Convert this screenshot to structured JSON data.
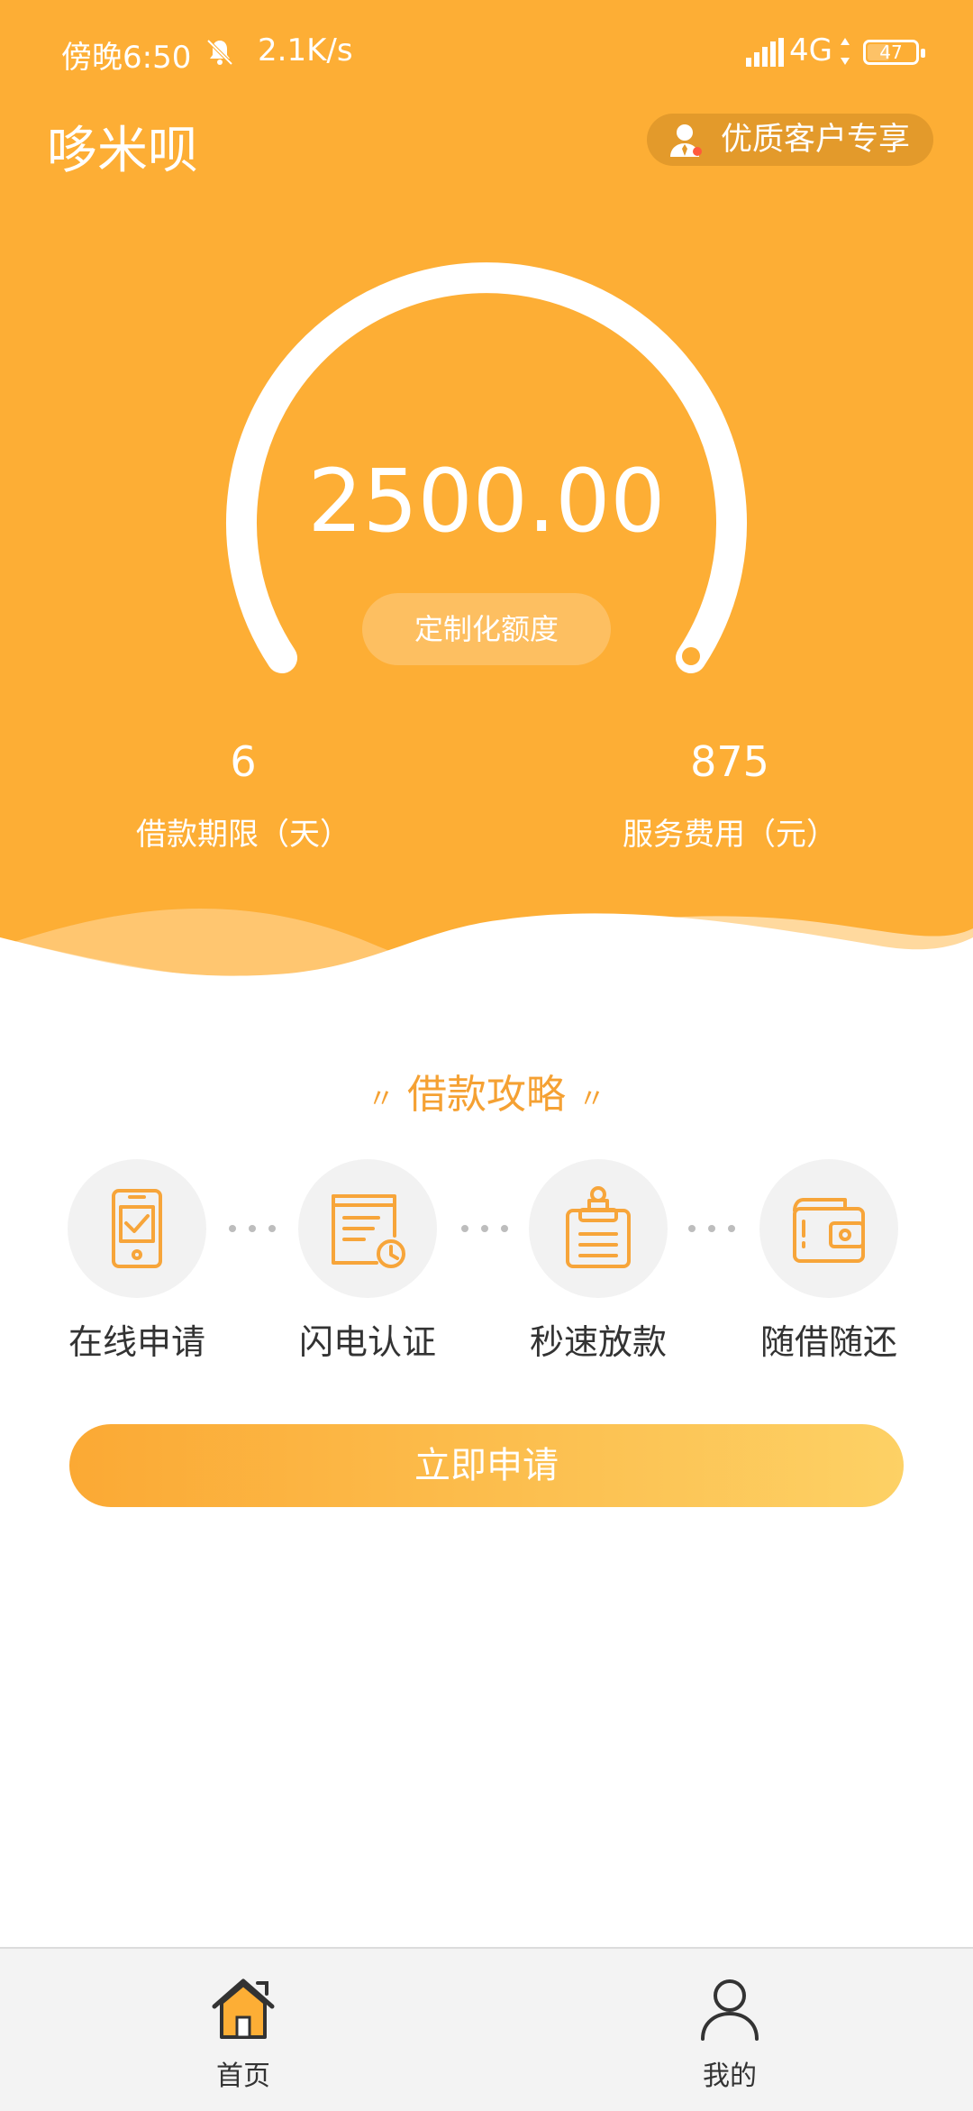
{
  "status_bar": {
    "time": "傍晚6:50",
    "network_speed": "2.1K/s",
    "network_type": "4G",
    "battery": "47",
    "battery_level": 0.47
  },
  "header": {
    "app_title": "哆米呗",
    "vip_label": "优质客户专享"
  },
  "loan": {
    "amount": "2500.00",
    "quota_label": "定制化额度",
    "term_value": "6",
    "term_label": "借款期限（天）",
    "fee_value": "875",
    "fee_label": "服务费用（元）"
  },
  "guide": {
    "title": "借款攻略",
    "steps": [
      {
        "label": "在线申请",
        "icon": "phone-check-icon"
      },
      {
        "label": "闪电认证",
        "icon": "document-clock-icon"
      },
      {
        "label": "秒速放款",
        "icon": "clipboard-stamp-icon"
      },
      {
        "label": "随借随还",
        "icon": "wallet-icon"
      }
    ]
  },
  "apply_button": "立即申请",
  "tabbar": {
    "items": [
      {
        "label": "首页",
        "icon": "home-icon",
        "active": true
      },
      {
        "label": "我的",
        "icon": "user-icon",
        "active": false
      }
    ]
  },
  "colors": {
    "primary": "#FDAE35",
    "accent_text": "#F5A133",
    "button_gradient_start": "#FBA934",
    "button_gradient_end": "#FDD165"
  }
}
